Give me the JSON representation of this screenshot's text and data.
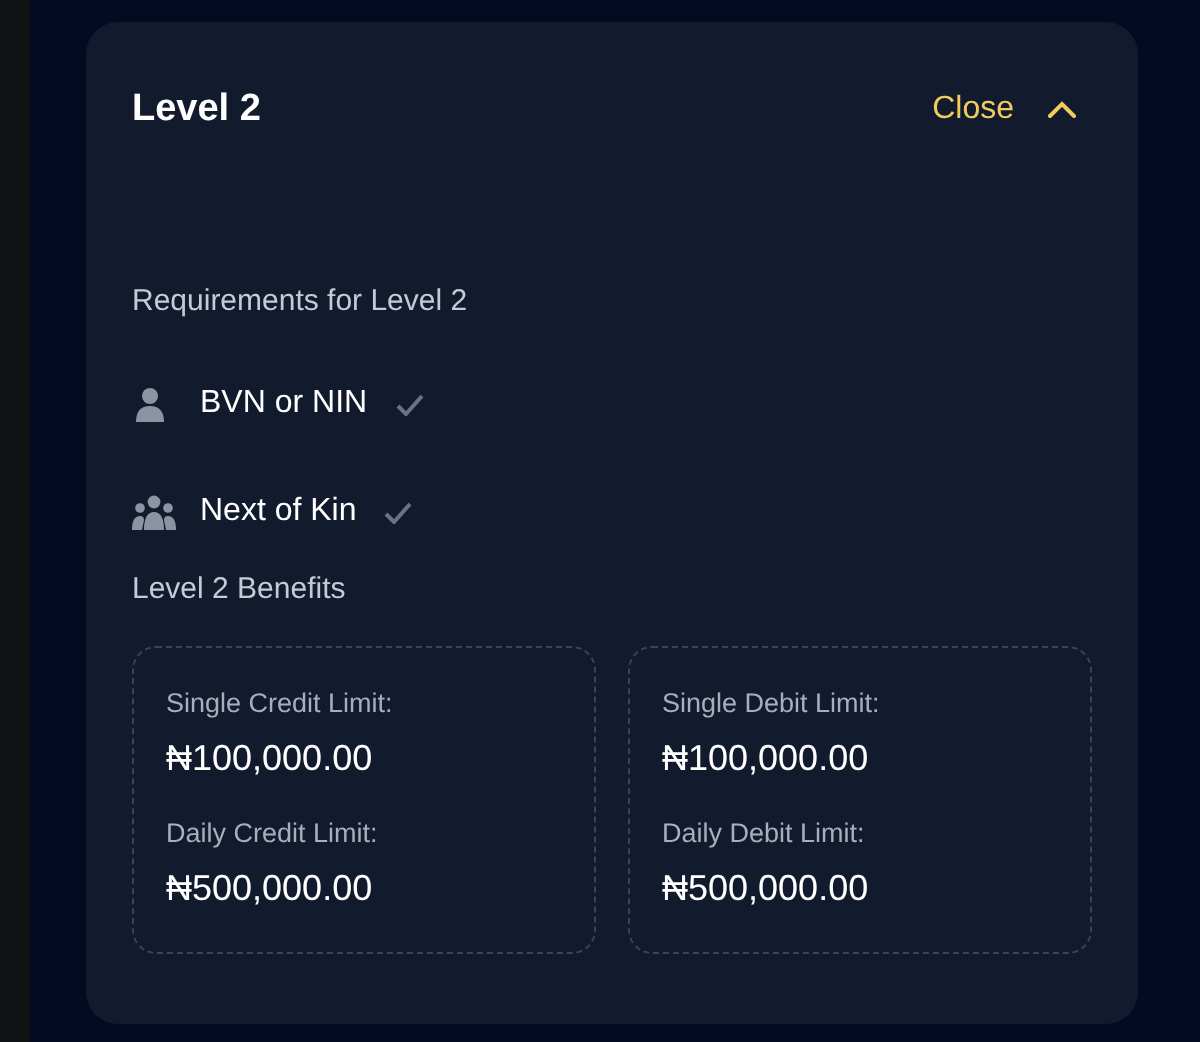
{
  "panel": {
    "title": "Level 2",
    "close": "Close",
    "expanded": true
  },
  "requirements_title": "Requirements for Level 2",
  "requirements": [
    {
      "kind": "person",
      "label": "BVN or NIN",
      "checked": true
    },
    {
      "kind": "group",
      "label": "Next of Kin",
      "checked": true
    }
  ],
  "benefits_title": "Level 2 Benefits",
  "benefits": [
    {
      "items": [
        {
          "label": "Single Credit Limit:",
          "value": "₦100,000.00"
        },
        {
          "label": "Daily Credit Limit:",
          "value": "₦500,000.00"
        }
      ]
    },
    {
      "items": [
        {
          "label": "Single Debit Limit:",
          "value": "₦100,000.00"
        },
        {
          "label": "Daily Debit Limit:",
          "value": "₦500,000.00"
        }
      ]
    }
  ]
}
